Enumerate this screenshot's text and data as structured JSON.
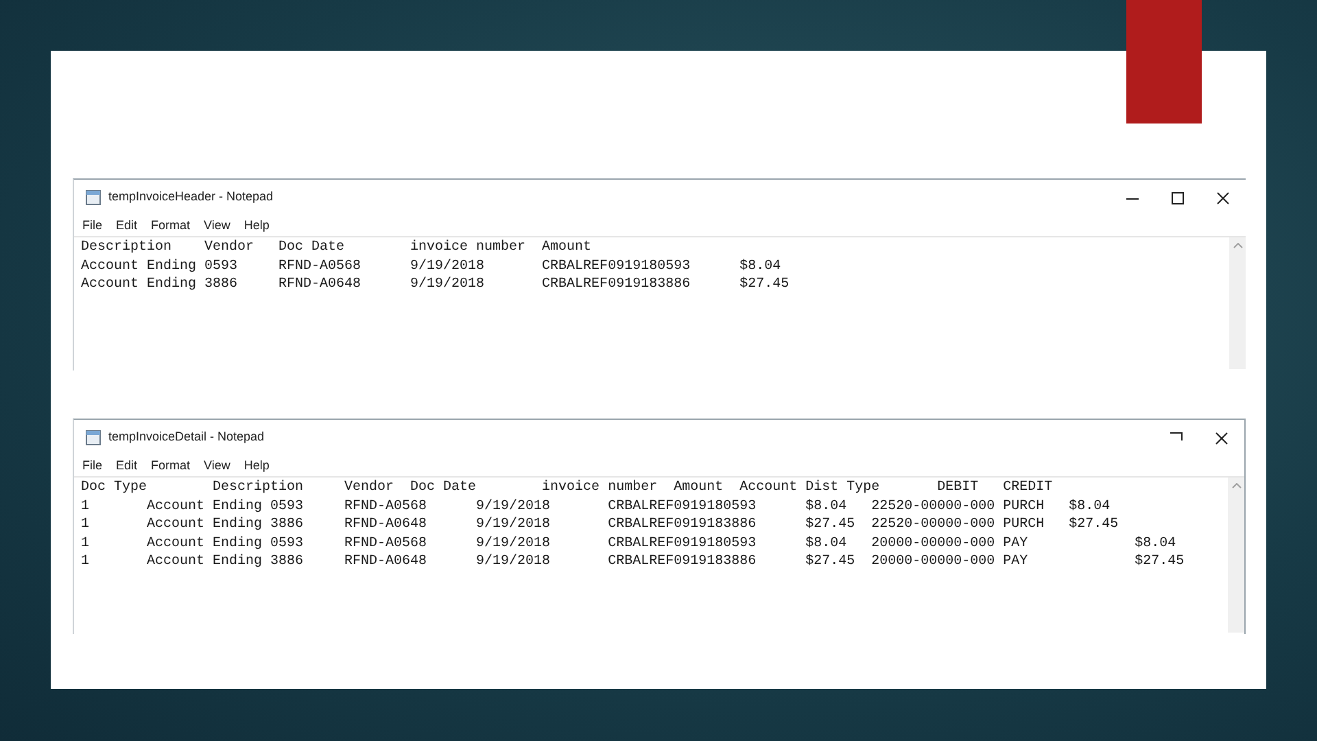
{
  "windows": [
    {
      "title": "tempInvoiceHeader - Notepad",
      "controls": [
        {
          "kind": "minimize"
        },
        {
          "kind": "maximize"
        },
        {
          "kind": "close"
        }
      ],
      "menu": [
        "File",
        "Edit",
        "Format",
        "View",
        "Help"
      ],
      "lines": [
        "Description    Vendor   Doc Date        invoice number  Amount",
        "Account Ending 0593     RFND-A0568      9/19/2018       CRBALREF0919180593      $8.04",
        "Account Ending 3886     RFND-A0648      9/19/2018       CRBALREF0919183886      $27.45"
      ]
    },
    {
      "title": "tempInvoiceDetail - Notepad",
      "controls": [
        {
          "kind": "corner"
        },
        {
          "kind": "close"
        }
      ],
      "menu": [
        "File",
        "Edit",
        "Format",
        "View",
        "Help"
      ],
      "lines": [
        "Doc Type        Description     Vendor  Doc Date        invoice number  Amount  Account Dist Type       DEBIT   CREDIT",
        "1       Account Ending 0593     RFND-A0568      9/19/2018       CRBALREF0919180593      $8.04   22520-00000-000 PURCH   $8.04",
        "1       Account Ending 3886     RFND-A0648      9/19/2018       CRBALREF0919183886      $27.45  22520-00000-000 PURCH   $27.45",
        "1       Account Ending 0593     RFND-A0568      9/19/2018       CRBALREF0919180593      $8.04   20000-00000-000 PAY             $8.04",
        "1       Account Ending 3886     RFND-A0648      9/19/2018       CRBALREF0919183886      $27.45  20000-00000-000 PAY             $27.45"
      ]
    }
  ]
}
